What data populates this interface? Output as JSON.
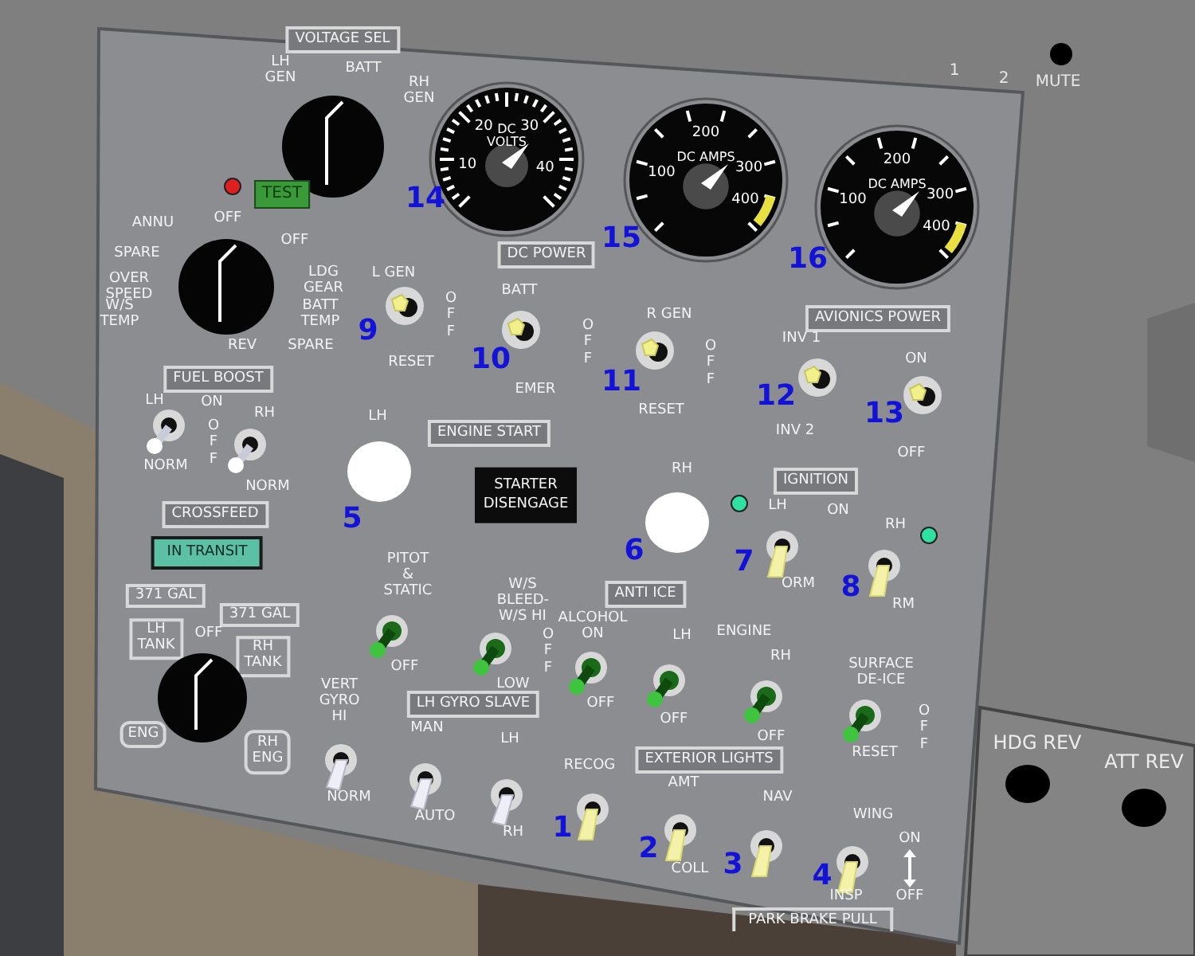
{
  "voltage_sel": {
    "title": "VOLTAGE SEL",
    "positions": [
      "LH GEN",
      "BATT",
      "RH GEN"
    ],
    "test_button": "TEST",
    "warning_light_on": true
  },
  "annunciator_selector": {
    "positions": [
      "ANNU",
      "OFF",
      "OFF",
      "SPARE",
      "OVER SPEED",
      "LDG GEAR",
      "W/S TEMP",
      "BATT TEMP",
      "REV",
      "SPARE"
    ]
  },
  "gauges": [
    {
      "title": "DC VOLTS",
      "scale": [
        "10",
        "20",
        "30",
        "40"
      ],
      "callout": "14",
      "kind": "volts"
    },
    {
      "title": "DC AMPS",
      "scale": [
        "100",
        "200",
        "300",
        "400"
      ],
      "callout": "15",
      "kind": "amps"
    },
    {
      "title": "DC AMPS",
      "scale": [
        "100",
        "200",
        "300",
        "400"
      ],
      "callout": "16",
      "kind": "amps"
    }
  ],
  "dc_power": {
    "title": "DC POWER",
    "switches": [
      {
        "label": "L GEN",
        "bottom": "RESET",
        "side": "OFF",
        "callout": "9",
        "kind": "nut",
        "on": true
      },
      {
        "label": "BATT",
        "bottom": "EMER",
        "side": "OFF",
        "callout": "10",
        "kind": "nut",
        "on": true
      },
      {
        "label": "R GEN",
        "bottom": "RESET",
        "side": "OFF",
        "callout": "11",
        "kind": "nut",
        "on": true
      }
    ]
  },
  "avionics_power": {
    "title": "AVIONICS POWER",
    "switches": [
      {
        "label": "INV 1",
        "bottom": "INV 2",
        "callout": "12",
        "kind": "nut",
        "on": true
      },
      {
        "label": "ON",
        "bottom": "OFF",
        "callout": "13",
        "kind": "nut",
        "on": true
      }
    ]
  },
  "fuel_boost": {
    "title": "FUEL BOOST",
    "on": "ON",
    "side": "OFF",
    "switches": [
      {
        "label": "LH",
        "bottom": "NORM",
        "kind": "ball",
        "on": false
      },
      {
        "label": "RH",
        "bottom": "NORM",
        "kind": "ball",
        "on": false
      }
    ]
  },
  "crossfeed": {
    "title": "CROSSFEED",
    "annunciator": "IN TRANSIT"
  },
  "fuel_selector": {
    "left_quantity": "371 GAL",
    "right_quantity": "371 GAL",
    "left_tank": "LH TANK",
    "right_tank": "RH TANK",
    "off": "OFF",
    "left_engine": "ENG",
    "right_engine": "RH ENG"
  },
  "engine_start": {
    "title": "ENGINE START",
    "buttons": [
      {
        "label": "LH",
        "callout": "5"
      },
      {
        "label": "RH",
        "callout": "6"
      }
    ],
    "disengage": "STARTER DISENGAGE"
  },
  "ignition": {
    "title": "IGNITION",
    "on": "ON",
    "switches": [
      {
        "label": "LH",
        "bottom": "ORM",
        "callout": "7",
        "kind": "paddle",
        "on": false,
        "light_on": true
      },
      {
        "label": "RH",
        "bottom": "RM",
        "callout": "8",
        "kind": "paddle",
        "on": false,
        "light_on": true
      }
    ]
  },
  "anti_ice": {
    "title": "ANTI ICE",
    "engine": "ENGINE",
    "side_labels": [
      "OFF",
      "OFF"
    ],
    "switches": [
      {
        "label": "PITOT & STATIC",
        "bottom": "OFF",
        "kind": "stick",
        "on": false
      },
      {
        "label": "W/S BLEED-W/S HI",
        "bottom": "LOW",
        "kind": "stick",
        "on": false
      },
      {
        "label": "ALCOHOL ON",
        "bottom": "OFF",
        "kind": "stick",
        "on": false
      },
      {
        "label": "LH",
        "bottom": "OFF",
        "kind": "stick",
        "on": false
      },
      {
        "label": "RH",
        "bottom": "OFF",
        "kind": "stick",
        "on": false
      },
      {
        "label": "SURFACE DE-ICE",
        "bottom": "RESET",
        "kind": "stick",
        "on": false
      }
    ]
  },
  "gyro": {
    "title": "LH GYRO SLAVE",
    "switches": [
      {
        "label": "VERT GYRO HI",
        "bottom": "NORM",
        "kind": "blade",
        "on": false
      },
      {
        "label": "MAN",
        "bottom": "AUTO",
        "kind": "blade",
        "on": false
      },
      {
        "label": "LH",
        "bottom": "RH",
        "kind": "blade",
        "on": false
      }
    ]
  },
  "exterior_lights": {
    "title": "EXTERIOR LIGHTS",
    "on": "ON",
    "off": "OFF",
    "park_brake": "PARK BRAKE PULL",
    "switches": [
      {
        "label": "RECOG",
        "callout": "1",
        "kind": "paddle",
        "on": false
      },
      {
        "label": "AMT",
        "bottom": "COLL",
        "callout": "2",
        "kind": "paddle",
        "on": false
      },
      {
        "label": "NAV",
        "callout": "3",
        "kind": "paddle",
        "on": false
      },
      {
        "label": "WING",
        "bottom": "INSP",
        "callout": "4",
        "kind": "paddle",
        "on": false
      }
    ]
  },
  "adjacent_panel": {
    "marker_labels": [
      "1",
      "2"
    ],
    "mute": "MUTE",
    "hdg_rev": "HDG REV",
    "att_rev": "ATT REV"
  }
}
